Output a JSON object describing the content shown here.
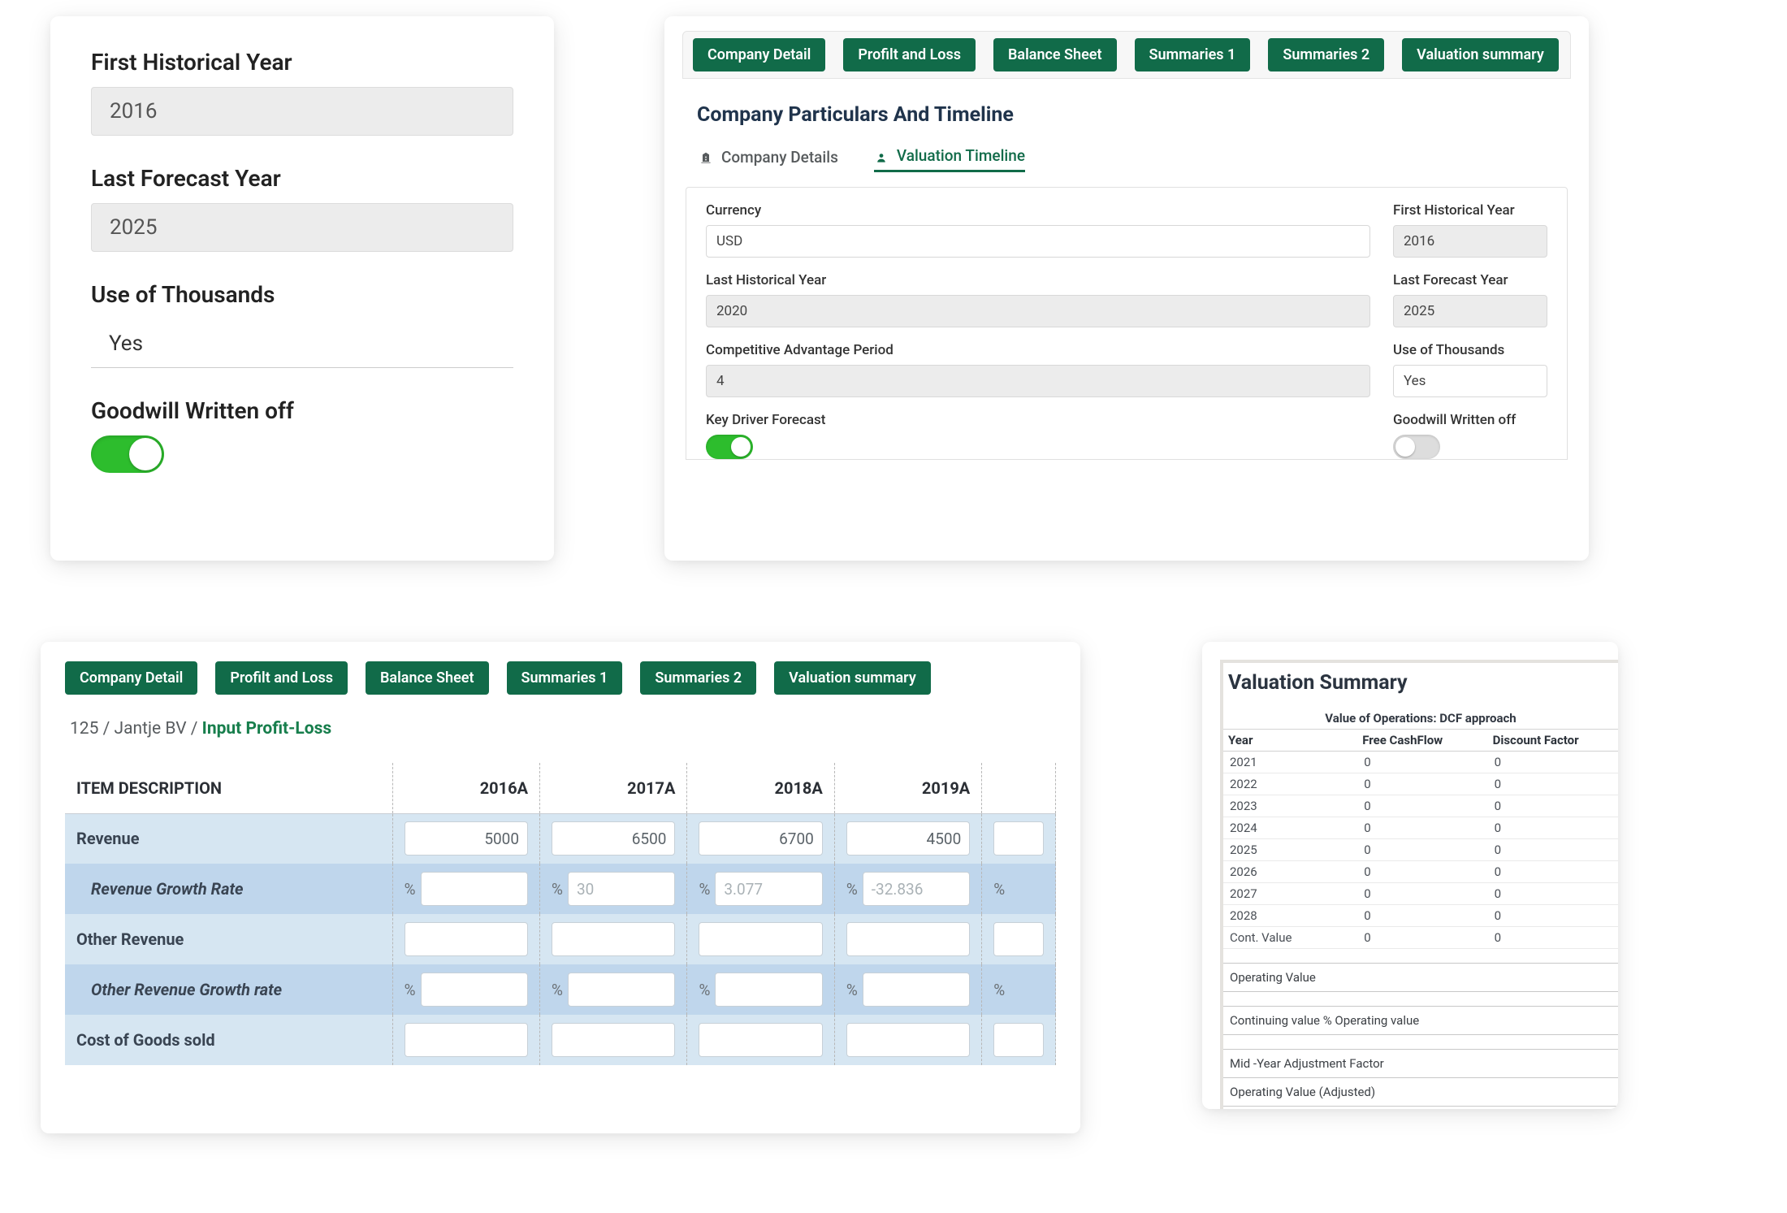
{
  "small_card": {
    "first_hist_label": "First Historical Year",
    "first_hist_value": "2016",
    "last_forecast_label": "Last Forecast Year",
    "last_forecast_value": "2025",
    "thousands_label": "Use of Thousands",
    "thousands_value": "Yes",
    "goodwill_label": "Goodwill Written off",
    "goodwill_on": true
  },
  "main_card": {
    "tabs": [
      "Company Detail",
      "Profilt and Loss",
      "Balance Sheet",
      "Summaries 1",
      "Summaries 2",
      "Valuation summary"
    ],
    "section_title": "Company Particulars And Timeline",
    "subtabs": {
      "company_details": "Company Details",
      "valuation_timeline": "Valuation Timeline"
    },
    "left": {
      "currency_label": "Currency",
      "currency_value": "USD",
      "last_hist_label": "Last Historical Year",
      "last_hist_value": "2020",
      "cap_label": "Competitive Advantage Period",
      "cap_value": "4",
      "kdf_label": "Key Driver Forecast",
      "kdf_on": true
    },
    "right": {
      "first_hist_label": "First Historical Year",
      "first_hist_value": "2016",
      "last_forecast_label": "Last Forecast Year",
      "last_forecast_value": "2025",
      "thousands_label": "Use of Thousands",
      "thousands_value": "Yes",
      "goodwill_label": "Goodwill Written off",
      "goodwill_on": false
    }
  },
  "pl_card": {
    "tabs": [
      "Company Detail",
      "Profilt and Loss",
      "Balance Sheet",
      "Summaries 1",
      "Summaries 2",
      "Valuation summary"
    ],
    "breadcrumb": {
      "seg1": "125",
      "seg2": "Jantje BV",
      "seg3": "Input Profit-Loss"
    },
    "headers": {
      "desc": "ITEM DESCRIPTION",
      "y2016": "2016A",
      "y2017": "2017A",
      "y2018": "2018A",
      "y2019": "2019A"
    },
    "rows": {
      "revenue": {
        "label": "Revenue",
        "y2016": "5000",
        "y2017": "6500",
        "y2018": "6700",
        "y2019": "4500"
      },
      "rev_growth": {
        "label": "Revenue Growth Rate",
        "y2017": "30",
        "y2018": "3.077",
        "y2019": "-32.836"
      },
      "other_rev": {
        "label": "Other Revenue"
      },
      "other_rev_growth": {
        "label": "Other Revenue Growth rate"
      },
      "cogs": {
        "label": "Cost of Goods sold"
      }
    },
    "pct": "%"
  },
  "vs_card": {
    "title": "Valuation Summary",
    "caption": "Value of Operations: DCF approach",
    "headers": {
      "year": "Year",
      "fcf": "Free CashFlow",
      "df": "Discount Factor"
    },
    "rows": [
      {
        "year": "2021",
        "fcf": "0",
        "df": "0"
      },
      {
        "year": "2022",
        "fcf": "0",
        "df": "0"
      },
      {
        "year": "2023",
        "fcf": "0",
        "df": "0"
      },
      {
        "year": "2024",
        "fcf": "0",
        "df": "0"
      },
      {
        "year": "2025",
        "fcf": "0",
        "df": "0"
      },
      {
        "year": "2026",
        "fcf": "0",
        "df": "0"
      },
      {
        "year": "2027",
        "fcf": "0",
        "df": "0"
      },
      {
        "year": "2028",
        "fcf": "0",
        "df": "0"
      },
      {
        "year": "Cont. Value",
        "fcf": "0",
        "df": "0"
      }
    ],
    "summary_rows": [
      "Operating Value",
      "Continuing value % Operating value",
      "Mid -Year Adjustment Factor",
      "Operating Value (Adjusted)"
    ]
  }
}
